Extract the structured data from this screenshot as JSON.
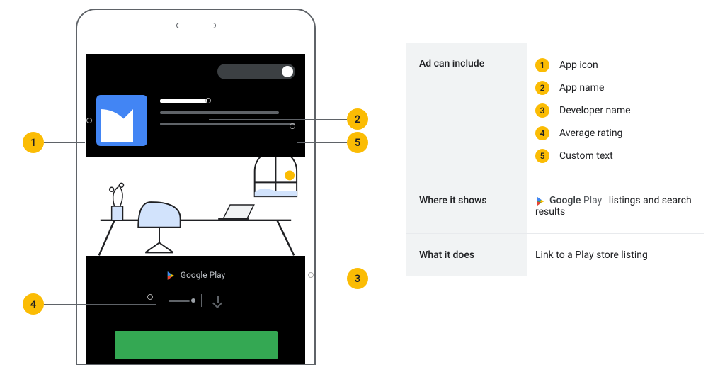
{
  "phone": {
    "top_panel": {
      "app_name_placeholder": "",
      "subline1": "",
      "subline2": ""
    },
    "bottom_panel": {
      "store_label": "Google Play",
      "cta_label": ""
    }
  },
  "callouts": {
    "c1": "1",
    "c2": "2",
    "c3": "3",
    "c4": "4",
    "c5": "5"
  },
  "info": {
    "row1": {
      "label": "Ad can include",
      "items": [
        {
          "num": "1",
          "text": "App icon"
        },
        {
          "num": "2",
          "text": "App name"
        },
        {
          "num": "3",
          "text": "Developer name"
        },
        {
          "num": "4",
          "text": "Average rating"
        },
        {
          "num": "5",
          "text": "Custom text"
        }
      ]
    },
    "row2": {
      "label": "Where it shows",
      "store_brand_a": "Google",
      "store_brand_b": "Play",
      "tail": " listings and search results"
    },
    "row3": {
      "label": "What it does",
      "text": "Link to a Play store listing"
    }
  }
}
